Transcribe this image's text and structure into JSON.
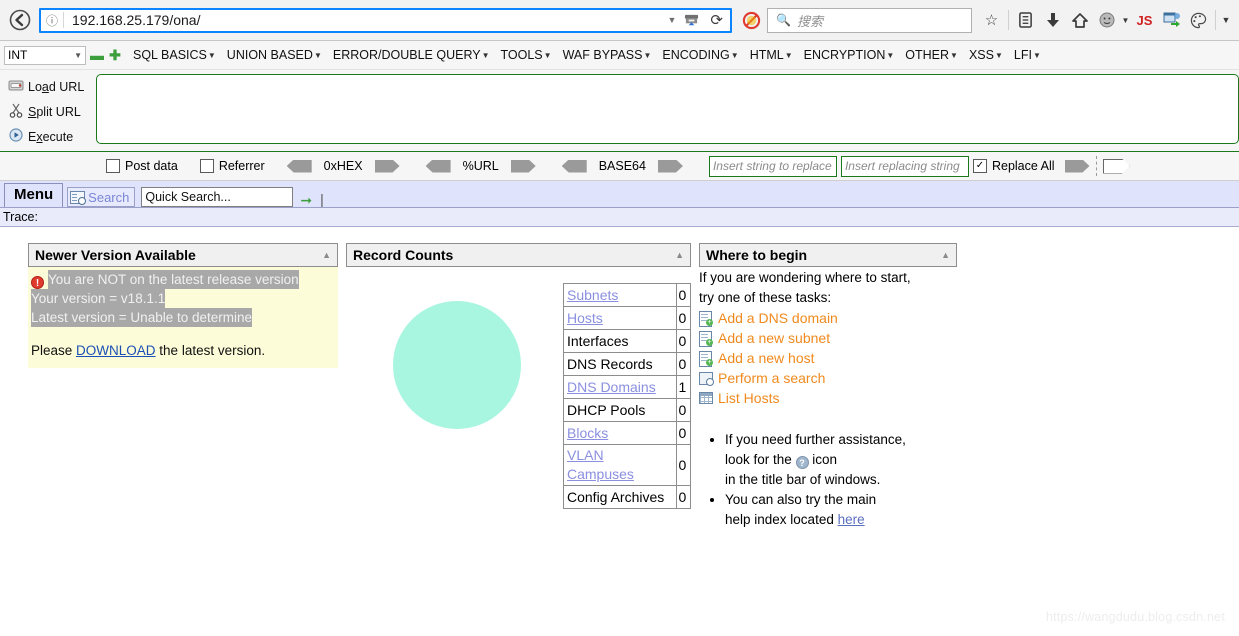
{
  "browser": {
    "back_icon": "back-arrow-icon",
    "info_icon": "info-icon",
    "url": "192.168.25.179/ona/",
    "dropdown_icon": "chevron-down-icon",
    "pocket_icon": "pocket-icon",
    "reload_icon": "reload-icon",
    "blocked_icon": "blocked-icon",
    "search_icon": "search-icon",
    "search_placeholder": "搜索",
    "toolbar_icons": [
      {
        "name": "bookmark-star-icon",
        "glyph": "☆"
      },
      {
        "name": "library-icon",
        "glyph": "▤"
      },
      {
        "name": "downloads-icon",
        "glyph": "⬇"
      },
      {
        "name": "home-icon",
        "glyph": "⌂"
      },
      {
        "name": "account-icon",
        "glyph": "☻"
      },
      {
        "name": "account-caret-icon",
        "glyph": "▾"
      },
      {
        "name": "javascript-switcher-icon",
        "glyph": "JS"
      },
      {
        "name": "hackbar-icon",
        "glyph": "⇲"
      },
      {
        "name": "theme-palette-icon",
        "glyph": "◔"
      },
      {
        "name": "overflow-menu-icon",
        "glyph": "▾"
      }
    ]
  },
  "hackbar": {
    "type_select": "INT",
    "caret_icon": "chevron-down-icon",
    "minus_icon": "minus-icon",
    "plus_icon": "plus-icon",
    "menus": [
      "SQL BASICS",
      "UNION BASED",
      "ERROR/DOUBLE QUERY",
      "TOOLS",
      "WAF BYPASS",
      "ENCODING",
      "HTML",
      "ENCRYPTION",
      "OTHER",
      "XSS",
      "LFI"
    ],
    "actions": [
      {
        "label_pre": "Lo",
        "label_acc": "a",
        "label_post": "d URL",
        "icon": "load-url-icon"
      },
      {
        "label_pre": "",
        "label_acc": "S",
        "label_post": "plit URL",
        "icon": "split-url-icon"
      },
      {
        "label_pre": "E",
        "label_acc": "x",
        "label_post": "ecute",
        "icon": "execute-icon"
      }
    ],
    "request_body": "",
    "options": {
      "post_data": "Post data",
      "post_data_checked": false,
      "referrer": "Referrer",
      "referrer_checked": false,
      "encoders": [
        "0xHEX",
        "%URL",
        "BASE64"
      ],
      "replace_from_placeholder": "Insert string to replace",
      "replace_to_placeholder": "Insert replacing string",
      "replace_all": "Replace All",
      "replace_all_checked": true
    }
  },
  "ona": {
    "menu_tab": "Menu",
    "search_button": "Search",
    "search_button_icon": "search-window-icon",
    "quick_search_value": "Quick Search...",
    "go_icon": "green-arrow-icon",
    "trace_label": "Trace:"
  },
  "panels": {
    "version": {
      "title": "Newer Version Available",
      "collapse_icon": "collapse-icon",
      "warn_icon": "warning-icon",
      "line1": "You are NOT on the latest release version",
      "line2": "Your version    = v18.1.1",
      "line3": "Latest version = Unable to determine",
      "please_pre": "Please ",
      "download_link": "DOWNLOAD",
      "please_post": " the latest version."
    },
    "records": {
      "title": "Record Counts",
      "collapse_icon": "collapse-icon",
      "chart_color": "#a8f5e0",
      "rows": [
        {
          "label": "Subnets",
          "count": "0",
          "link": true
        },
        {
          "label": "Hosts",
          "count": "0",
          "link": true
        },
        {
          "label": "Interfaces",
          "count": "0",
          "link": false
        },
        {
          "label": "DNS Records",
          "count": "0",
          "link": false
        },
        {
          "label": "DNS Domains",
          "count": "1",
          "link": true
        },
        {
          "label": "DHCP Pools",
          "count": "0",
          "link": false
        },
        {
          "label": "Blocks",
          "count": "0",
          "link": true
        },
        {
          "label": "VLAN Campuses",
          "count": "0",
          "link": true
        },
        {
          "label": "Config Archives",
          "count": "0",
          "link": false
        }
      ]
    },
    "begin": {
      "title": "Where to begin",
      "collapse_icon": "collapse-icon",
      "intro_line1": "If you are wondering where to start,",
      "intro_line2": "try one of these tasks:",
      "tasks": [
        {
          "label": "Add a DNS domain",
          "icon": "add-document-icon"
        },
        {
          "label": "Add a new subnet",
          "icon": "add-document-icon"
        },
        {
          "label": "Add a new host",
          "icon": "add-document-icon"
        },
        {
          "label": "Perform a search",
          "icon": "search-window-icon"
        },
        {
          "label": "List Hosts",
          "icon": "grid-list-icon"
        }
      ],
      "bullet1_a": "If you need further assistance,",
      "bullet1_b": "look for the ",
      "bullet1_icon": "help-icon",
      "bullet1_c": " icon",
      "bullet1_d": "in the title bar of windows.",
      "bullet2_a": "You can also try the main",
      "bullet2_b": "help index located ",
      "bullet2_link": "here"
    }
  },
  "watermark": "https://wangdudu.blog.csdn.net",
  "chart_data": {
    "type": "pie",
    "title": "Record Counts",
    "categories": [
      "Subnets",
      "Hosts",
      "Interfaces",
      "DNS Records",
      "DNS Domains",
      "DHCP Pools",
      "Blocks",
      "VLAN Campuses",
      "Config Archives"
    ],
    "values": [
      0,
      0,
      0,
      0,
      1,
      0,
      0,
      0,
      0
    ],
    "colors": [
      "#a8f5e0"
    ],
    "legend": "table",
    "xlabel": "",
    "ylabel": ""
  }
}
